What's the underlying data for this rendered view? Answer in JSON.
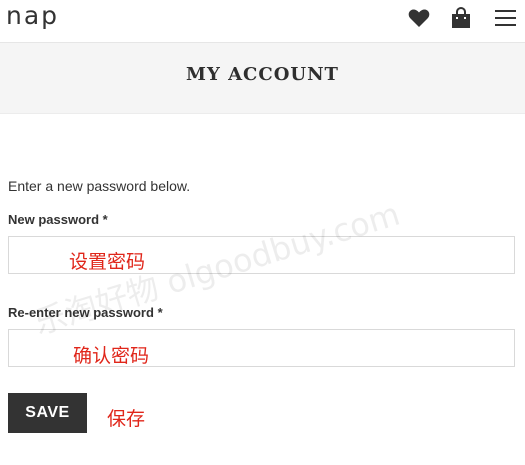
{
  "header": {
    "logo": "nap",
    "icons": [
      "heart-icon",
      "shopping-bag-icon",
      "menu-icon"
    ]
  },
  "hero": {
    "title": "MY ACCOUNT"
  },
  "form": {
    "intro": "Enter a new password below.",
    "new_password_label": "New password",
    "reenter_password_label": "Re-enter new password",
    "required_marker": "*",
    "new_password_value": "",
    "reenter_password_value": "",
    "save_label": "SAVE"
  },
  "annotations": {
    "new_password": "设置密码",
    "reenter_password": "确认密码",
    "save": "保存"
  },
  "watermark": "乐淘好物 olgoodbuy.com",
  "colors": {
    "accent": "#e0261a",
    "button_bg": "#333333",
    "hero_bg": "#f5f5f5"
  }
}
